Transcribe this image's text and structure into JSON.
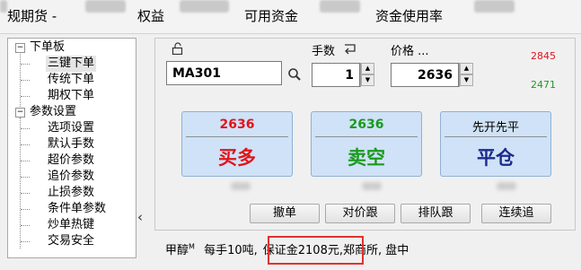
{
  "topbar": {
    "futures_suffix": "规期货 -",
    "equity_label": "权益",
    "available_label": "可用资金",
    "usage_label": "资金使用率"
  },
  "tree": {
    "groups": [
      {
        "label": "下单板",
        "expanded": true,
        "items": [
          "三键下单",
          "传统下单",
          "期权下单"
        ],
        "selected": "三键下单"
      },
      {
        "label": "参数设置",
        "expanded": true,
        "items": [
          "选项设置",
          "默认手数",
          "超价参数",
          "追价参数",
          "止损参数",
          "条件单参数",
          "炒单热键",
          "交易安全"
        ]
      }
    ],
    "collapse_glyph": "‹"
  },
  "order": {
    "contract": "MA301",
    "qty_label": "手数",
    "qty": "1",
    "price_label": "价格 ...",
    "price": "2636",
    "side_prices": {
      "high": "2845",
      "low": "2471"
    }
  },
  "buttons": {
    "buy": {
      "price": "2636",
      "label": "买多",
      "color": "#e1141b"
    },
    "sell": {
      "price": "2636",
      "label": "卖空",
      "color": "#1a9a1f"
    },
    "close": {
      "top": "先开先平",
      "label": "平仓",
      "color": "#1c2a8c"
    },
    "cancel": "撤单",
    "counter_price": "对价跟",
    "queue": "排队跟",
    "chase": "连续追"
  },
  "footer": {
    "product": "甲醇",
    "product_mark": "M",
    "lot": "每手10吨,",
    "margin": "保证金2108元,",
    "exchange": "郑商所, 盘中"
  }
}
